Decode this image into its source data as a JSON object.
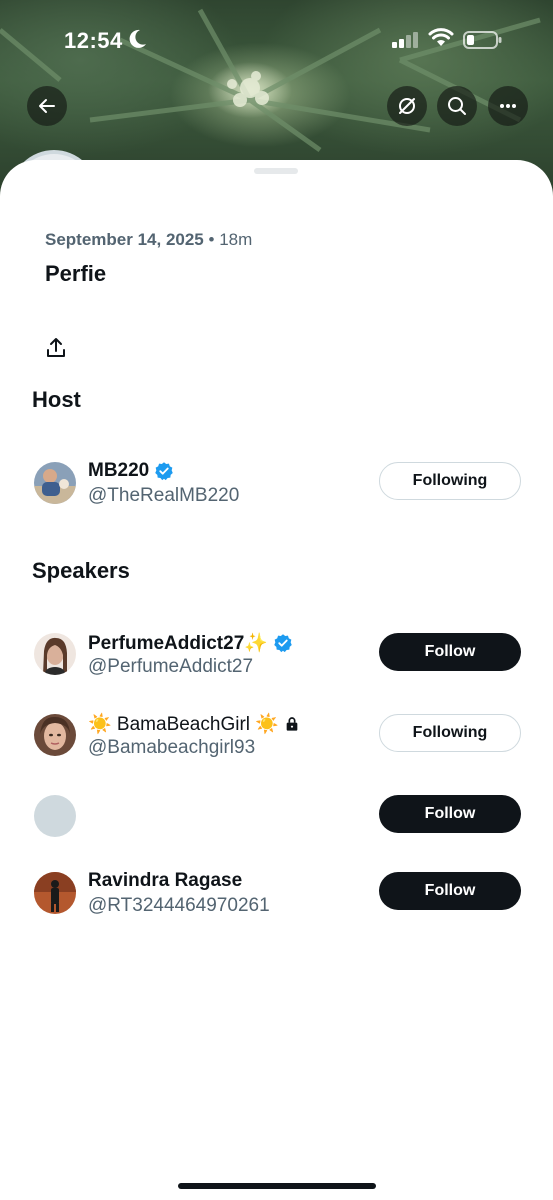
{
  "status_bar": {
    "time": "12:54"
  },
  "space": {
    "date": "September 14, 2025",
    "separator": "•",
    "duration": "18m",
    "title": "Perfie"
  },
  "sections": {
    "host": "Host",
    "speakers": "Speakers"
  },
  "host": {
    "name": "MB220",
    "handle": "@TheRealMB220",
    "verified": true,
    "button": "Following"
  },
  "speakers": [
    {
      "name": "PerfumeAddict27✨",
      "handle": "@PerfumeAddict27",
      "verified": true,
      "button": "Follow"
    },
    {
      "name": "☀️ BamaBeachGirl ☀️",
      "handle": "@Bamabeachgirl93",
      "locked": true,
      "button": "Following"
    },
    {
      "name": "",
      "handle": "",
      "button": "Follow"
    },
    {
      "name": "Ravindra Ragase",
      "handle": "@RT3244464970261",
      "button": "Follow"
    }
  ],
  "colors": {
    "accent_blue": "#1d9bf0",
    "text_primary": "#0f1419",
    "text_secondary": "#536471"
  }
}
